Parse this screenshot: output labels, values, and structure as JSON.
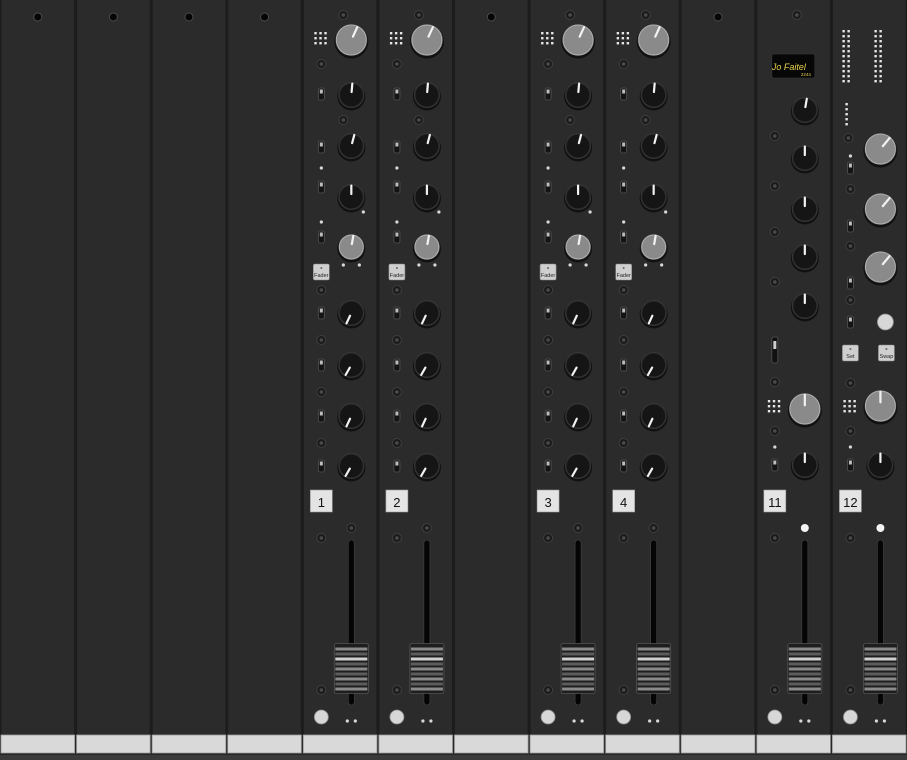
{
  "logo": {
    "text": "Jo Faitel",
    "subtext": "2244"
  },
  "labels": {
    "fader": "Fader",
    "set": "Set",
    "swap": "Swap"
  },
  "channels": [
    {
      "type": "blank"
    },
    {
      "type": "blank"
    },
    {
      "type": "blank"
    },
    {
      "type": "blank"
    },
    {
      "type": "channel",
      "label": "1",
      "fader_level": 0.1,
      "fader_button": true
    },
    {
      "type": "channel",
      "label": "2",
      "fader_level": 0.1,
      "fader_button": true
    },
    {
      "type": "blank"
    },
    {
      "type": "channel",
      "label": "3",
      "fader_level": 0.1,
      "fader_button": true
    },
    {
      "type": "channel",
      "label": "4",
      "fader_level": 0.1,
      "fader_button": true
    },
    {
      "type": "blank"
    },
    {
      "type": "master",
      "label": "11",
      "fader_level": 0.1
    },
    {
      "type": "master",
      "label": "12",
      "fader_level": 0.1
    }
  ],
  "colors": {
    "panel": "#2b2b2b",
    "panel_edge": "#1c1c1c",
    "label_strip": "#d9d9d9",
    "knob": "#151515",
    "knob_grey": "#8a8a8a",
    "logo_text": "#e8d24a"
  }
}
